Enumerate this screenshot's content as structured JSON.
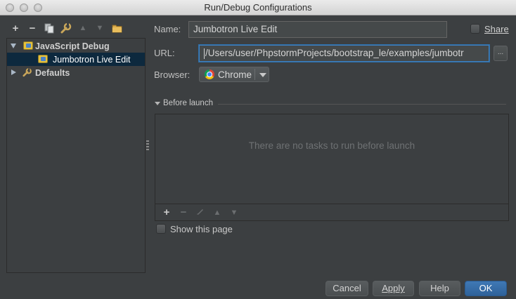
{
  "window": {
    "title": "Run/Debug Configurations"
  },
  "toolbar": {
    "add": "+",
    "remove": "−",
    "copy_icon": "copy-icon",
    "edit_defaults_icon": "wrench-icon",
    "move_up": "▲",
    "move_down": "▼",
    "folder_icon": "folder-icon"
  },
  "tree": {
    "items": [
      {
        "label": "JavaScript Debug",
        "icon": "javascript-debug-icon",
        "expanded": true
      },
      {
        "label": "Jumbotron Live Edit",
        "icon": "javascript-debug-icon",
        "selected": true
      },
      {
        "label": "Defaults",
        "icon": "wrench-icon",
        "expanded": false
      }
    ]
  },
  "form": {
    "name_label": "Name:",
    "name_value": "Jumbotron Live Edit",
    "share_label": "Share",
    "share_checked": false,
    "url_label": "URL:",
    "url_value": "/Users/user/PhpstormProjects/bootstrap_le/examples/jumbotr",
    "browse_label": "...",
    "browser_label": "Browser:",
    "browser_value": "Chrome",
    "browser_icon": "chrome-icon"
  },
  "before_launch": {
    "header": "Before launch",
    "empty_text": "There are no tasks to run before launch",
    "add": "+",
    "remove": "−",
    "edit_icon": "pencil-icon",
    "move_up": "▲",
    "move_down": "▼"
  },
  "show_page": {
    "label": "Show this page",
    "checked": false
  },
  "buttons": {
    "cancel": "Cancel",
    "apply": "Apply",
    "help": "Help",
    "ok": "OK"
  },
  "colors": {
    "background": "#3c3f41",
    "selection": "#0d293e",
    "primary_button": "#3874b0",
    "focus_border": "#3d7fbf"
  }
}
